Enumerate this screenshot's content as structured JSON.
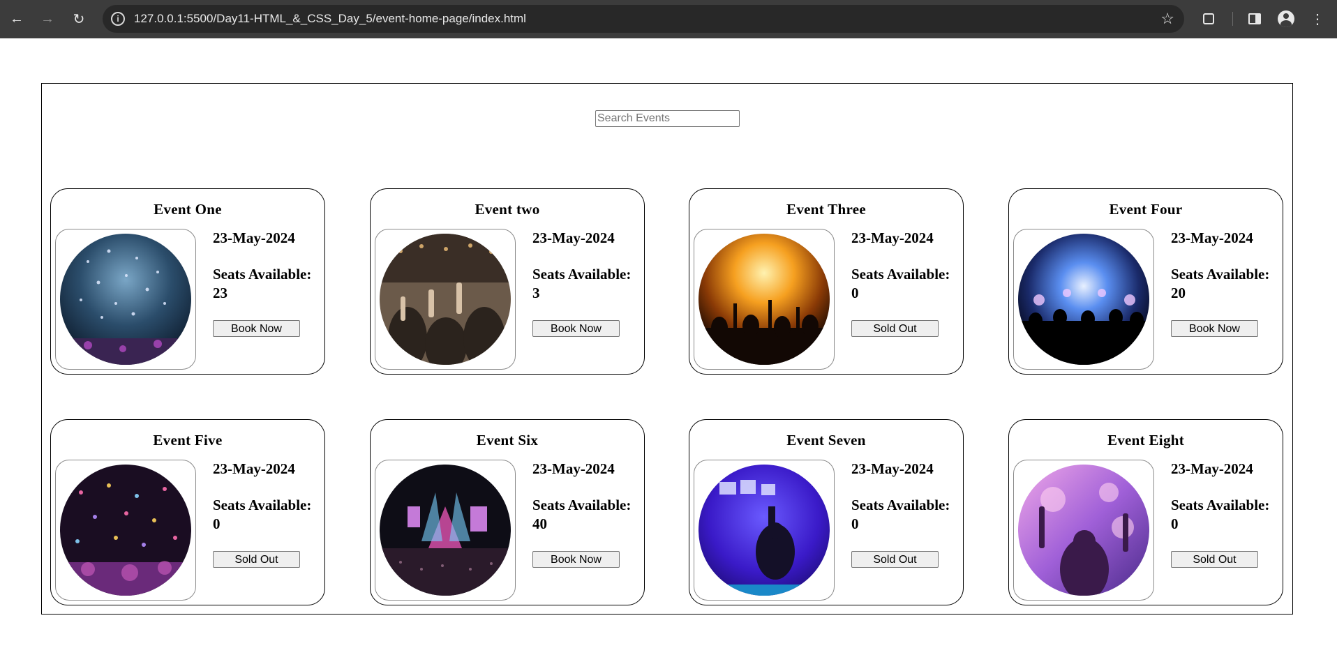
{
  "browser": {
    "url": "127.0.0.1:5500/Day11-HTML_&_CSS_Day_5/event-home-page/index.html",
    "icons": [
      "back-arrow-icon",
      "forward-arrow-icon",
      "reload-icon",
      "site-info-icon",
      "bookmark-star-icon",
      "extensions-icon",
      "side-panel-icon",
      "profile-icon",
      "menu-kebab-icon"
    ]
  },
  "search": {
    "placeholder": "Search Events",
    "value": ""
  },
  "events": [
    {
      "title": "Event One",
      "date": "23-May-2024",
      "seats_label": "Seats Available: 23",
      "seats": 23,
      "button": "Book Now"
    },
    {
      "title": "Event two",
      "date": "23-May-2024",
      "seats_label": "Seats Available: 3",
      "seats": 3,
      "button": "Book Now"
    },
    {
      "title": "Event Three",
      "date": "23-May-2024",
      "seats_label": "Seats Available: 0",
      "seats": 0,
      "button": "Sold Out"
    },
    {
      "title": "Event Four",
      "date": "23-May-2024",
      "seats_label": "Seats Available: 20",
      "seats": 20,
      "button": "Book Now"
    },
    {
      "title": "Event Five",
      "date": "23-May-2024",
      "seats_label": "Seats Available: 0",
      "seats": 0,
      "button": "Sold Out"
    },
    {
      "title": "Event Six",
      "date": "23-May-2024",
      "seats_label": "Seats Available: 40",
      "seats": 40,
      "button": "Book Now"
    },
    {
      "title": "Event Seven",
      "date": "23-May-2024",
      "seats_label": "Seats Available: 0",
      "seats": 0,
      "button": "Sold Out"
    },
    {
      "title": "Event Eight",
      "date": "23-May-2024",
      "seats_label": "Seats Available: 0",
      "seats": 0,
      "button": "Sold Out"
    }
  ],
  "colors": {
    "chrome_bg": "#3c3c3c",
    "omnibox_bg": "#282828",
    "button_bg": "#efefef"
  }
}
